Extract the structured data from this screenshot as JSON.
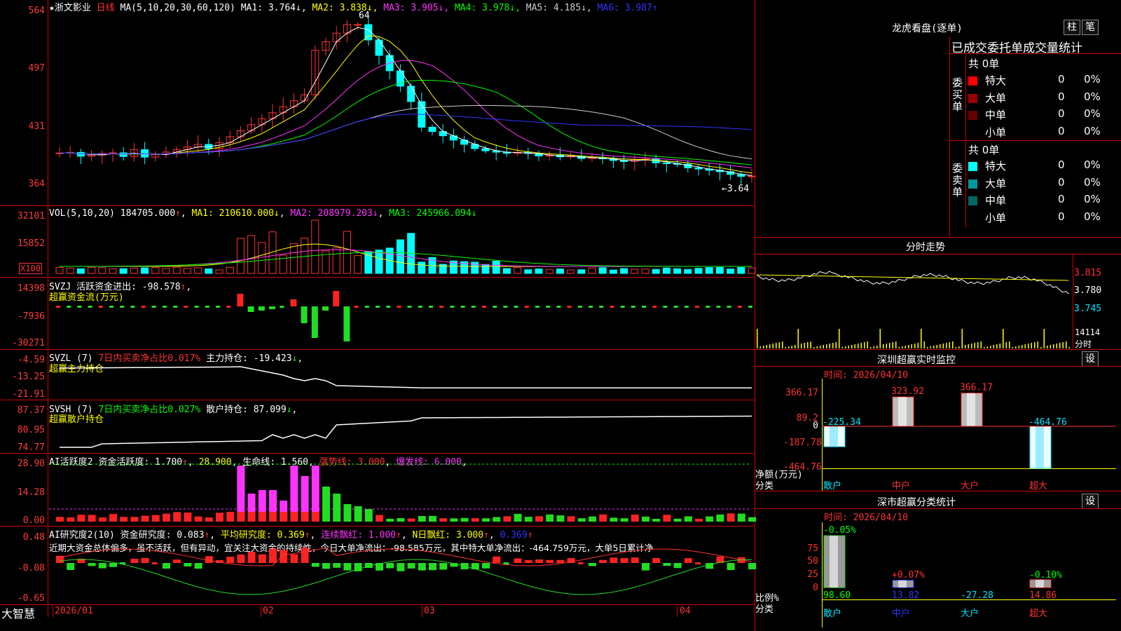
{
  "main": {
    "title_star": "★",
    "stock_name": "浙文影业",
    "period": "日线",
    "ma_params": "MA(5,10,20,30,60,120)",
    "ma": [
      {
        "label": "MA1:",
        "value": "3.764",
        "arrow": "↓",
        "color": "#ffffff"
      },
      {
        "label": "MA2:",
        "value": "3.838",
        "arrow": "↓",
        "color": "#ffff00"
      },
      {
        "label": "MA3:",
        "value": "3.905",
        "arrow": "↓",
        "color": "#ff33ff"
      },
      {
        "label": "MA4:",
        "value": "3.978",
        "arrow": "↓",
        "color": "#00ff00"
      },
      {
        "label": "MA5:",
        "value": "4.185",
        "arrow": "↓",
        "color": "#cccccc"
      },
      {
        "label": "MA6:",
        "value": "3.987",
        "arrow": "↑",
        "color": "#3333ff"
      }
    ],
    "y_ticks": [
      "564",
      "497",
      "431",
      "364"
    ],
    "high_label": "64",
    "low_label": "←3.64"
  },
  "vol": {
    "title": "VOL(5,10,20)",
    "value": "184705.000",
    "value_arrow": "↑",
    "ma1": "MA1: 210610.000",
    "ma1_arrow": "↓",
    "ma2": "MA2: 208979.203",
    "ma2_arrow": "↓",
    "ma3": "MA3: 245966.094",
    "ma3_arrow": "↓",
    "y_ticks": [
      "32101",
      "15852"
    ],
    "unit": "X100"
  },
  "svzj": {
    "title": "SVZJ",
    "desc": "活跃资金进出: -98.578",
    "arrow": "↑",
    "subtitle": "超赢资金流(万元)",
    "y_ticks": [
      "14398",
      "-7936",
      "-30271"
    ]
  },
  "svzl": {
    "title": "SVZL (7)",
    "desc1": "7日内买卖净占比0.017%",
    "desc2": "主力持仓: -19.423",
    "arrow": "↓",
    "subtitle": "超赢主力持仓",
    "y_ticks": [
      "-4.59",
      "-13.25",
      "-21.91"
    ]
  },
  "svsh": {
    "title": "SVSH (7)",
    "desc1": "7日内买卖净占比0.027%",
    "desc2": "散户持仓: 87.099",
    "arrow": "↓",
    "subtitle": "超赢散户持仓",
    "y_ticks": [
      "87.37",
      "80.95",
      "74.77"
    ]
  },
  "ai1": {
    "title": "AI活跃度2",
    "d1": "资金活跃度: 1.700",
    "d1a": "↑",
    "d2": "28.900",
    "d3": "生命线: 1.560",
    "d4": "强势线: 3.000",
    "d5": "爆发线: 6.000",
    "y_ticks": [
      "28.90",
      "14.28",
      "0.00"
    ]
  },
  "ai2": {
    "title": "AI研究度2(10)",
    "d1": "资金研究度: 0.083",
    "d1a": "↑",
    "d2": "平均研究度: 0.369",
    "d2a": "↑",
    "d3": "连续飘红: 1.000",
    "d3a": "↑",
    "d4": "N日飘红: 3.000",
    "d4a": "↑",
    "d5": "0.369",
    "d5a": "↑",
    "comment": "近期大资金总体偏多，虽不活跃，但有异动，宜关注大资金的持续性，今日大单净流出：-98.585万元，其中特大单净流出：-464.759万元，大单5日累计净",
    "y_ticks": [
      "0.48",
      "-0.08",
      "-0.65"
    ]
  },
  "x_axis": {
    "brand": "大智慧",
    "labels": [
      "2026/01",
      "02",
      "03",
      "04"
    ]
  },
  "right": {
    "dragon_title": "龙虎看盘(逐单)",
    "btn_zhu": "柱",
    "btn_bi": "笔",
    "stat_title": "已成交委托单成交量统计",
    "buy": {
      "side": "委买单",
      "total": "共 0单",
      "rows": [
        {
          "name": "特大",
          "count": "0",
          "pct": "0%",
          "color": "#ff0000"
        },
        {
          "name": "大单",
          "count": "0",
          "pct": "0%",
          "color": "#990000"
        },
        {
          "name": "中单",
          "count": "0",
          "pct": "0%",
          "color": "#660000"
        },
        {
          "name": "小单",
          "count": "0",
          "pct": "0%",
          "color": "#000000"
        }
      ]
    },
    "sell": {
      "side": "委卖单",
      "total": "共 0单",
      "rows": [
        {
          "name": "特大",
          "count": "0",
          "pct": "0%",
          "color": "#00ffff"
        },
        {
          "name": "大单",
          "count": "0",
          "pct": "0%",
          "color": "#009999"
        },
        {
          "name": "中单",
          "count": "0",
          "pct": "0%",
          "color": "#006666"
        },
        {
          "name": "小单",
          "count": "0",
          "pct": "0%",
          "color": "#000000"
        }
      ]
    },
    "intraday": {
      "title": "分时走势",
      "prices": [
        "3.815",
        "3.780",
        "3.745"
      ],
      "vol": "14114",
      "vol_unit": "分时"
    },
    "sz_monitor": {
      "title": "深圳超赢实时监控",
      "btn": "设",
      "time": "时间: 2026/04/10",
      "y_ticks": [
        "366.17",
        "89.2",
        "0",
        "-187.78",
        "-464.76"
      ],
      "y_label": "净额(万元)",
      "x_label": "分类",
      "categories": [
        "散户",
        "中户",
        "大户",
        "超大"
      ],
      "values": [
        -225.34,
        323.92,
        366.17,
        -464.76
      ],
      "value_labels": [
        "-225.34",
        "323.92",
        "366.17",
        "-464.76"
      ]
    },
    "sz_class": {
      "title": "深市超赢分类统计",
      "btn": "设",
      "time": "时间: 2026/04/10",
      "y_ticks": [
        "75",
        "50",
        "25",
        "0"
      ],
      "y_label": "比例%",
      "x_label": "分类",
      "categories": [
        "散户",
        "中户",
        "大户",
        "超大"
      ],
      "values": [
        98.6,
        13.82,
        -27.28,
        14.86
      ],
      "value_labels": [
        "98.60",
        "13.82",
        "-27.28",
        "14.86"
      ],
      "change_labels": [
        "-0.05%",
        "+0.07%",
        "",
        "-0.10%"
      ]
    }
  },
  "chart_data": [
    {
      "type": "candlestick",
      "title": "浙文影业 日线",
      "ylim": [
        3.64,
        5.64
      ],
      "x": [
        "2026/01",
        "02",
        "03",
        "04"
      ],
      "series": [
        {
          "name": "MA1",
          "values": [
            3.764
          ]
        },
        {
          "name": "MA2",
          "values": [
            3.838
          ]
        },
        {
          "name": "MA3",
          "values": [
            3.905
          ]
        },
        {
          "name": "MA4",
          "values": [
            3.978
          ]
        },
        {
          "name": "MA5",
          "values": [
            4.185
          ]
        },
        {
          "name": "MA6",
          "values": [
            3.987
          ]
        }
      ],
      "high": 5.64,
      "low": 3.64
    },
    {
      "type": "bar",
      "title": "VOL(5,10,20)",
      "values": [
        184705.0
      ],
      "ylim": [
        0,
        32101
      ]
    },
    {
      "type": "bar",
      "title": "深圳超赢实时监控",
      "categories": [
        "散户",
        "中户",
        "大户",
        "超大"
      ],
      "values": [
        -225.34,
        323.92,
        366.17,
        -464.76
      ],
      "ylabel": "净额(万元)",
      "ylim": [
        -464.76,
        366.17
      ]
    },
    {
      "type": "bar",
      "title": "深市超赢分类统计",
      "categories": [
        "散户",
        "中户",
        "大户",
        "超大"
      ],
      "values": [
        98.6,
        13.82,
        -27.28,
        14.86
      ],
      "ylabel": "比例%"
    }
  ]
}
